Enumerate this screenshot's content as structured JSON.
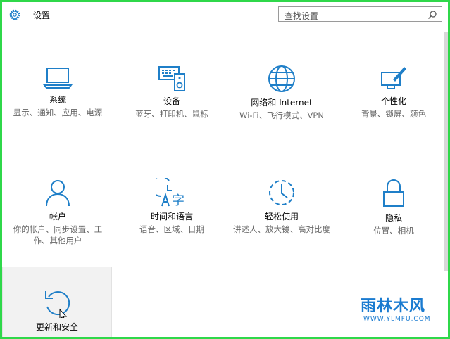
{
  "window": {
    "title": "设置"
  },
  "search": {
    "placeholder": "查找设置"
  },
  "tiles": [
    {
      "name": "系统",
      "desc": "显示、通知、应用、电源",
      "icon": "laptop-icon"
    },
    {
      "name": "设备",
      "desc": "蓝牙、打印机、鼠标",
      "icon": "devices-icon"
    },
    {
      "name": "网络和 Internet",
      "desc": "Wi-Fi、飞行模式、VPN",
      "icon": "globe-icon"
    },
    {
      "name": "个性化",
      "desc": "背景、锁屏、颜色",
      "icon": "personalize-icon"
    },
    {
      "name": "帐户",
      "desc": "你的帐户、同步设置、工作、其他用户",
      "icon": "person-icon"
    },
    {
      "name": "时间和语言",
      "desc": "语音、区域、日期",
      "icon": "time-language-icon"
    },
    {
      "name": "轻松使用",
      "desc": "讲述人、放大镜、高对比度",
      "icon": "ease-of-access-icon"
    },
    {
      "name": "隐私",
      "desc": "位置、相机",
      "icon": "lock-icon"
    },
    {
      "name": "更新和安全",
      "desc": "",
      "icon": "update-icon"
    }
  ],
  "watermark": {
    "text": "雨林木风",
    "url": "WWW.YLMFU.COM"
  },
  "colors": {
    "accent": "#1f7fc8",
    "frame": "#2fd84a"
  }
}
